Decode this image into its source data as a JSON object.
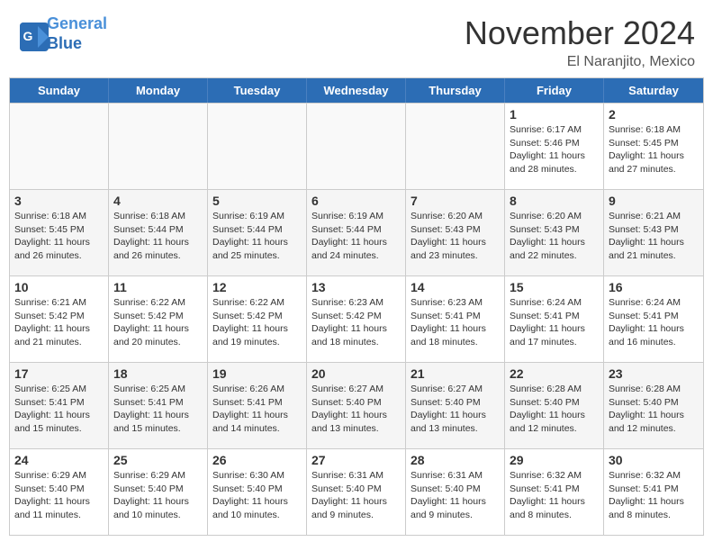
{
  "header": {
    "logo_line1": "General",
    "logo_line2": "Blue",
    "month": "November 2024",
    "location": "El Naranjito, Mexico"
  },
  "weekdays": [
    "Sunday",
    "Monday",
    "Tuesday",
    "Wednesday",
    "Thursday",
    "Friday",
    "Saturday"
  ],
  "weeks": [
    [
      {
        "day": "",
        "info": "",
        "empty": true
      },
      {
        "day": "",
        "info": "",
        "empty": true
      },
      {
        "day": "",
        "info": "",
        "empty": true
      },
      {
        "day": "",
        "info": "",
        "empty": true
      },
      {
        "day": "",
        "info": "",
        "empty": true
      },
      {
        "day": "1",
        "info": "Sunrise: 6:17 AM\nSunset: 5:46 PM\nDaylight: 11 hours and 28 minutes."
      },
      {
        "day": "2",
        "info": "Sunrise: 6:18 AM\nSunset: 5:45 PM\nDaylight: 11 hours and 27 minutes."
      }
    ],
    [
      {
        "day": "3",
        "info": "Sunrise: 6:18 AM\nSunset: 5:45 PM\nDaylight: 11 hours and 26 minutes."
      },
      {
        "day": "4",
        "info": "Sunrise: 6:18 AM\nSunset: 5:44 PM\nDaylight: 11 hours and 26 minutes."
      },
      {
        "day": "5",
        "info": "Sunrise: 6:19 AM\nSunset: 5:44 PM\nDaylight: 11 hours and 25 minutes."
      },
      {
        "day": "6",
        "info": "Sunrise: 6:19 AM\nSunset: 5:44 PM\nDaylight: 11 hours and 24 minutes."
      },
      {
        "day": "7",
        "info": "Sunrise: 6:20 AM\nSunset: 5:43 PM\nDaylight: 11 hours and 23 minutes."
      },
      {
        "day": "8",
        "info": "Sunrise: 6:20 AM\nSunset: 5:43 PM\nDaylight: 11 hours and 22 minutes."
      },
      {
        "day": "9",
        "info": "Sunrise: 6:21 AM\nSunset: 5:43 PM\nDaylight: 11 hours and 21 minutes."
      }
    ],
    [
      {
        "day": "10",
        "info": "Sunrise: 6:21 AM\nSunset: 5:42 PM\nDaylight: 11 hours and 21 minutes."
      },
      {
        "day": "11",
        "info": "Sunrise: 6:22 AM\nSunset: 5:42 PM\nDaylight: 11 hours and 20 minutes."
      },
      {
        "day": "12",
        "info": "Sunrise: 6:22 AM\nSunset: 5:42 PM\nDaylight: 11 hours and 19 minutes."
      },
      {
        "day": "13",
        "info": "Sunrise: 6:23 AM\nSunset: 5:42 PM\nDaylight: 11 hours and 18 minutes."
      },
      {
        "day": "14",
        "info": "Sunrise: 6:23 AM\nSunset: 5:41 PM\nDaylight: 11 hours and 18 minutes."
      },
      {
        "day": "15",
        "info": "Sunrise: 6:24 AM\nSunset: 5:41 PM\nDaylight: 11 hours and 17 minutes."
      },
      {
        "day": "16",
        "info": "Sunrise: 6:24 AM\nSunset: 5:41 PM\nDaylight: 11 hours and 16 minutes."
      }
    ],
    [
      {
        "day": "17",
        "info": "Sunrise: 6:25 AM\nSunset: 5:41 PM\nDaylight: 11 hours and 15 minutes."
      },
      {
        "day": "18",
        "info": "Sunrise: 6:25 AM\nSunset: 5:41 PM\nDaylight: 11 hours and 15 minutes."
      },
      {
        "day": "19",
        "info": "Sunrise: 6:26 AM\nSunset: 5:41 PM\nDaylight: 11 hours and 14 minutes."
      },
      {
        "day": "20",
        "info": "Sunrise: 6:27 AM\nSunset: 5:40 PM\nDaylight: 11 hours and 13 minutes."
      },
      {
        "day": "21",
        "info": "Sunrise: 6:27 AM\nSunset: 5:40 PM\nDaylight: 11 hours and 13 minutes."
      },
      {
        "day": "22",
        "info": "Sunrise: 6:28 AM\nSunset: 5:40 PM\nDaylight: 11 hours and 12 minutes."
      },
      {
        "day": "23",
        "info": "Sunrise: 6:28 AM\nSunset: 5:40 PM\nDaylight: 11 hours and 12 minutes."
      }
    ],
    [
      {
        "day": "24",
        "info": "Sunrise: 6:29 AM\nSunset: 5:40 PM\nDaylight: 11 hours and 11 minutes."
      },
      {
        "day": "25",
        "info": "Sunrise: 6:29 AM\nSunset: 5:40 PM\nDaylight: 11 hours and 10 minutes."
      },
      {
        "day": "26",
        "info": "Sunrise: 6:30 AM\nSunset: 5:40 PM\nDaylight: 11 hours and 10 minutes."
      },
      {
        "day": "27",
        "info": "Sunrise: 6:31 AM\nSunset: 5:40 PM\nDaylight: 11 hours and 9 minutes."
      },
      {
        "day": "28",
        "info": "Sunrise: 6:31 AM\nSunset: 5:40 PM\nDaylight: 11 hours and 9 minutes."
      },
      {
        "day": "29",
        "info": "Sunrise: 6:32 AM\nSunset: 5:41 PM\nDaylight: 11 hours and 8 minutes."
      },
      {
        "day": "30",
        "info": "Sunrise: 6:32 AM\nSunset: 5:41 PM\nDaylight: 11 hours and 8 minutes."
      }
    ]
  ]
}
